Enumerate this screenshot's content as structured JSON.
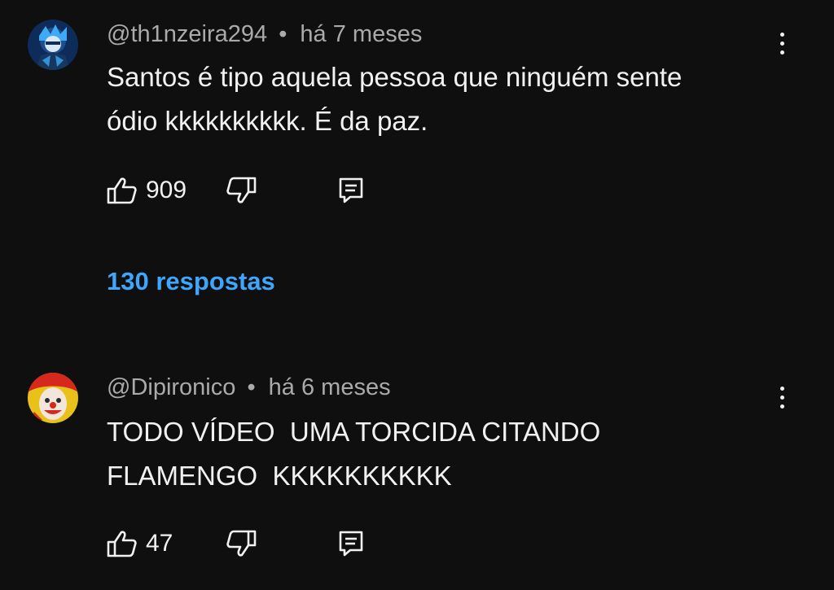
{
  "comments": [
    {
      "handle": "@th1nzeira294",
      "separator": "•",
      "time": "há 7 meses",
      "text_lines": [
        "Santos é tipo aquela pessoa que ninguém sente",
        "ódio kkkkkkkkkk. É da paz."
      ],
      "likes": "909",
      "replies_label": "130 respostas",
      "avatar_colors": {
        "bg": "#0d2c5a",
        "accent": "#3fa9f5"
      }
    },
    {
      "handle": "@Dipironico",
      "separator": "•",
      "time": "há 6 meses",
      "text_lines": [
        "TODO VÍDEO  UMA TORCIDA CITANDO",
        "FLAMENGO  KKKKKKKKKK"
      ],
      "likes": "47",
      "avatar_colors": {
        "bg": "#e8c21a",
        "accent": "#d6281c"
      }
    }
  ],
  "icons": {
    "like": "thumbs-up-icon",
    "dislike": "thumbs-down-icon",
    "reply": "reply-comment-icon",
    "menu": "more-vert-icon"
  },
  "colors": {
    "background": "#0f0f0f",
    "text": "#f1f1f1",
    "meta": "#aaaaaa",
    "link": "#3ea6ff"
  }
}
